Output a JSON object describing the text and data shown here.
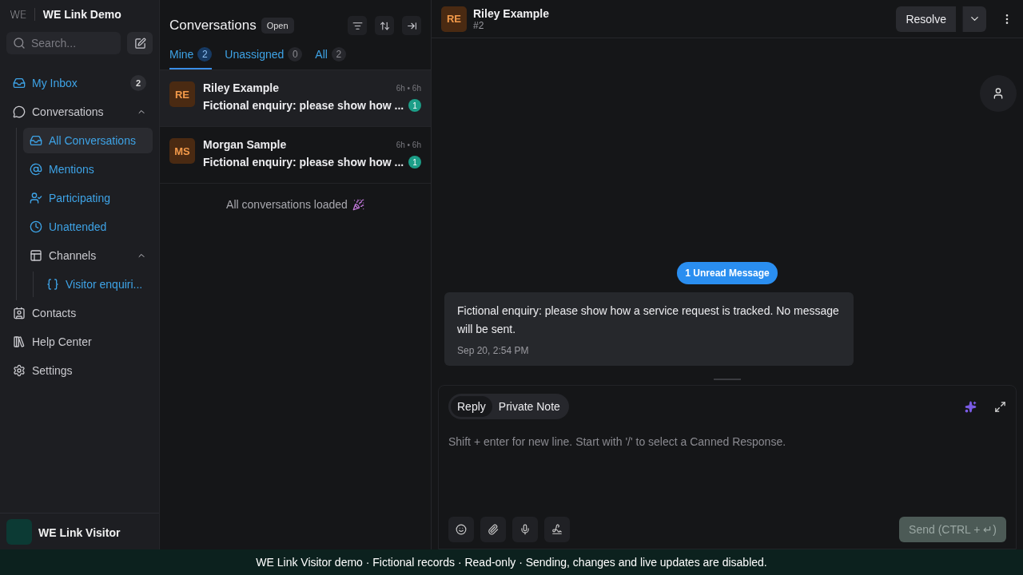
{
  "sidebar": {
    "logo": "WE",
    "title": "WE Link Demo",
    "search": {
      "placeholder": "Search..."
    },
    "items": [
      {
        "label": "My Inbox",
        "accent": true,
        "badge": "2"
      },
      {
        "label": "Conversations",
        "accent": false,
        "expanded": true,
        "children": [
          {
            "label": "All Conversations",
            "accent": true,
            "selected": true
          },
          {
            "label": "Mentions",
            "accent": true,
            "selected": false
          },
          {
            "label": "Participating",
            "accent": true,
            "selected": false
          },
          {
            "label": "Unattended",
            "accent": true,
            "selected": false
          },
          {
            "label": "Channels",
            "accent": false,
            "selected": false,
            "expanded": true,
            "children": [
              {
                "label": "Visitor enquiri...",
                "accent": true,
                "selected": false
              }
            ]
          }
        ]
      },
      {
        "label": "Contacts",
        "accent": false
      },
      {
        "label": "Help Center",
        "accent": false
      },
      {
        "label": "Settings",
        "accent": false
      }
    ],
    "account": {
      "name": "WE Link Visitor"
    }
  },
  "list": {
    "title": "Conversations",
    "status": "Open",
    "tabs": [
      {
        "label": "Mine",
        "count": "2",
        "selected": true
      },
      {
        "label": "Unassigned",
        "count": "0",
        "selected": false
      },
      {
        "label": "All",
        "count": "2",
        "selected": false
      }
    ],
    "conversations": [
      {
        "initials": "RE",
        "name": "Riley Example",
        "time": "6h • 6h",
        "preview": "Fictional enquiry: please show how ...",
        "unread": "1",
        "selected": true
      },
      {
        "initials": "MS",
        "name": "Morgan Sample",
        "time": "6h • 6h",
        "preview": "Fictional enquiry: please show how ...",
        "unread": "1",
        "selected": false
      }
    ],
    "footer": "All conversations loaded"
  },
  "chat": {
    "initials": "RE",
    "name": "Riley Example",
    "number": "#2",
    "resolve": "Resolve",
    "unread": "1 Unread Message",
    "message": {
      "text": "Fictional enquiry: please show how a service request is tracked. No message will be sent.",
      "time": "Sep 20, 2:54 PM"
    },
    "composer": {
      "tabs": [
        {
          "label": "Reply",
          "selected": true
        },
        {
          "label": "Private Note",
          "selected": false
        }
      ],
      "placeholder": "Shift + enter for new line. Start with '/' to select a Canned Response.",
      "send": "Send (CTRL + ↵)"
    }
  },
  "banner": "WE Link Visitor demo · Fictional records · Read-only · Sending, changes and live updates are disabled."
}
